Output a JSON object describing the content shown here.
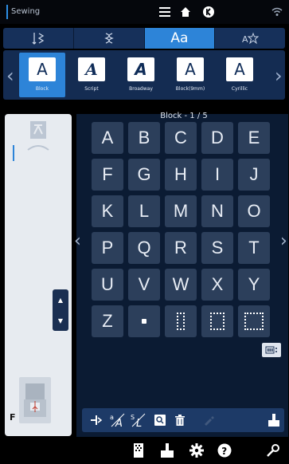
{
  "status_bar": {
    "title": "Sewing",
    "icons": [
      "menu-icon",
      "home-icon",
      "back-icon",
      "wifi-icon"
    ]
  },
  "category_tabs": [
    {
      "name": "stitch-tab",
      "label": "",
      "active": false
    },
    {
      "name": "decorative-tab",
      "label": "",
      "active": false
    },
    {
      "name": "alphabet-tab",
      "label": "Aa",
      "active": true
    },
    {
      "name": "favorites-tab",
      "label": "",
      "active": false
    }
  ],
  "fonts": [
    {
      "label": "Block",
      "glyph": "A",
      "active": true
    },
    {
      "label": "Script",
      "glyph": "A",
      "active": false
    },
    {
      "label": "Broadway",
      "glyph": "A",
      "active": false
    },
    {
      "label": "Block(9mm)",
      "glyph": "A",
      "active": false
    },
    {
      "label": "Cyrillic",
      "glyph": "A",
      "active": false
    }
  ],
  "grid": {
    "title": "Block - 1 / 5",
    "keys": [
      "A",
      "B",
      "C",
      "D",
      "E",
      "F",
      "G",
      "H",
      "I",
      "J",
      "K",
      "L",
      "M",
      "N",
      "O",
      "P",
      "Q",
      "R",
      "S",
      "T",
      "U",
      "V",
      "W",
      "X",
      "Y",
      "Z"
    ]
  },
  "left_panel": {
    "presser_foot": "F"
  },
  "colors": {
    "accent": "#2d84d8",
    "panel": "#142c52",
    "key": "#2c3f5b"
  }
}
